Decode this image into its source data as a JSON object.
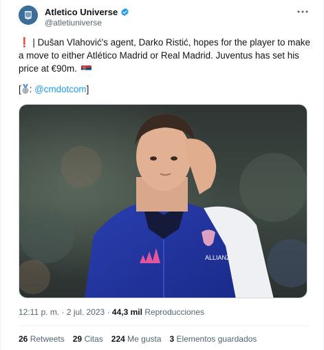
{
  "author": {
    "name": "Atletico Universe",
    "handle": "@atletiuniverse",
    "verified": true
  },
  "tweet": {
    "text_line_prefix": "❗",
    "text": "| Dušan Vlahović's agent, Darko Ristić, hopes for the player to make a move to either Atlético Madrid or Real Madrid. Juventus has set his price at €90m.",
    "source_prefix": "[",
    "source_link": "@cmdotcom",
    "source_suffix": "]",
    "source_separator": ":"
  },
  "meta": {
    "time": "12:11 p. m.",
    "sep": "·",
    "date": "2 jul. 2023",
    "views_count": "44,3 mil",
    "views_label": "Reproducciones"
  },
  "stats": [
    {
      "count": "26",
      "label": "Retweets"
    },
    {
      "count": "29",
      "label": "Citas"
    },
    {
      "count": "224",
      "label": "Me gusta"
    },
    {
      "count": "3",
      "label": "Elementos guardados"
    }
  ],
  "colors": {
    "link": "#1d9bf0",
    "secondary_text": "#536471",
    "verified": "#1d9bf0"
  },
  "icons": {
    "more": "more-horizontal-icon",
    "verified": "verified-badge-icon",
    "flag": "serbia-flag-icon",
    "medal": "silver-medal-icon"
  }
}
